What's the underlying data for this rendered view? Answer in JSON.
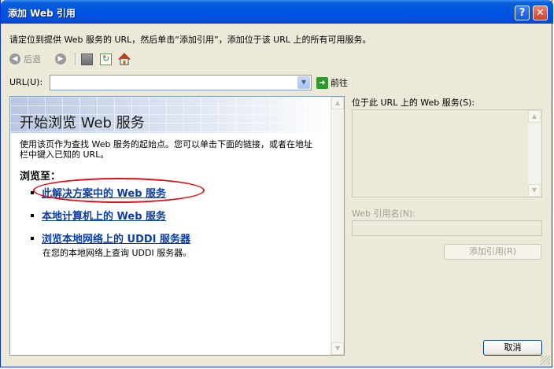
{
  "window": {
    "title": "添加 Web 引用",
    "help_glyph": "?",
    "close_glyph": "✕"
  },
  "instruction": "请定位到提供 Web 服务的 URL，然后单击“添加引用”，添加位于该 URL 上的所有可用服务。",
  "toolbar": {
    "back_label": "后退",
    "back_icon": "back-arrow-icon",
    "forward_icon": "forward-arrow-icon",
    "stop_icon": "stop-icon",
    "refresh_icon": "refresh-icon",
    "home_icon": "home-icon"
  },
  "url_bar": {
    "label": "URL(U):",
    "value": "",
    "go_label": "前往"
  },
  "browser": {
    "title": "开始浏览 Web 服务",
    "intro": "使用该页作为查找 Web 服务的起始点。您可以单击下面的链接，或者在地址栏中键入已知的 URL。",
    "browse_to_label": "浏览至：",
    "links": [
      {
        "label": "此解决方案中的 Web 服务"
      },
      {
        "label": "本地计算机上的 Web 服务"
      },
      {
        "label": "浏览本地网络上的 UDDI 服务器",
        "description": "在您的本地网络上查询 UDDI 服务器。"
      }
    ]
  },
  "right_panel": {
    "services_label": "位于此 URL 上的 Web 服务(S):",
    "ref_name_label": "Web 引用名(N):",
    "ref_name_value": "",
    "add_reference_label": "添加引用(R)"
  },
  "footer": {
    "cancel_label": "取消"
  },
  "colors": {
    "titlebar": "#0054e3",
    "dialog_bg": "#ece9d8",
    "link": "#0b3da6",
    "highlight": "#e0101a"
  }
}
